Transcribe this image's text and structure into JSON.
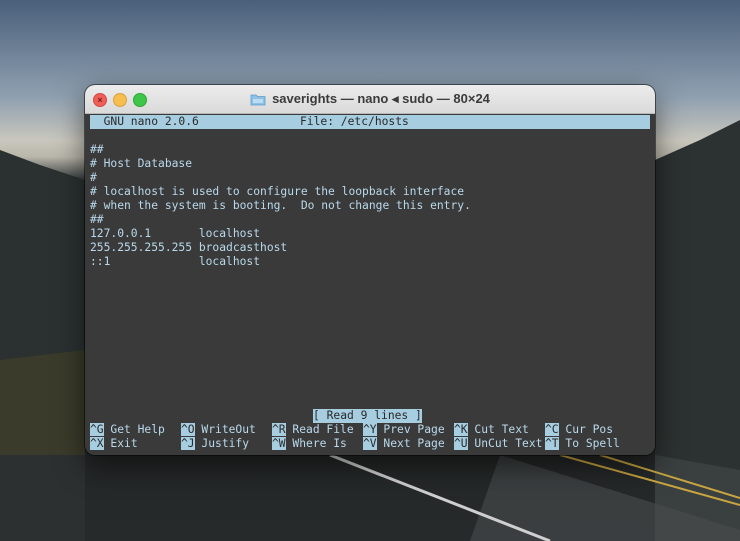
{
  "window": {
    "title": "saverights — nano ◂ sudo — 80×24"
  },
  "nano": {
    "version": "  GNU nano 2.0.6",
    "file_label": "File: /etc/hosts",
    "lines": [
      "",
      "##",
      "# Host Database",
      "#",
      "# localhost is used to configure the loopback interface",
      "# when the system is booting.  Do not change this entry.",
      "##",
      "127.0.0.1       localhost",
      "255.255.255.255 broadcasthost",
      "::1             localhost"
    ],
    "status": "[ Read 9 lines ]"
  },
  "shortcuts": [
    {
      "key": "^G",
      "label": " Get Help"
    },
    {
      "key": "^O",
      "label": " WriteOut"
    },
    {
      "key": "^R",
      "label": " Read File"
    },
    {
      "key": "^Y",
      "label": " Prev Page"
    },
    {
      "key": "^K",
      "label": " Cut Text"
    },
    {
      "key": "^C",
      "label": " Cur Pos"
    },
    {
      "key": "^X",
      "label": " Exit"
    },
    {
      "key": "^J",
      "label": " Justify"
    },
    {
      "key": "^W",
      "label": " Where Is"
    },
    {
      "key": "^V",
      "label": " Next Page"
    },
    {
      "key": "^U",
      "label": " UnCut Text"
    },
    {
      "key": "^T",
      "label": " To Spell"
    }
  ],
  "colors": {
    "terminal_bg": "#3a3a3a",
    "terminal_fg": "#b9d9ec",
    "highlight_bg": "#a6cde0"
  },
  "icons": {
    "close": "close-icon",
    "minimize": "minimize-icon",
    "maximize": "maximize-icon",
    "folder": "folder-icon"
  }
}
